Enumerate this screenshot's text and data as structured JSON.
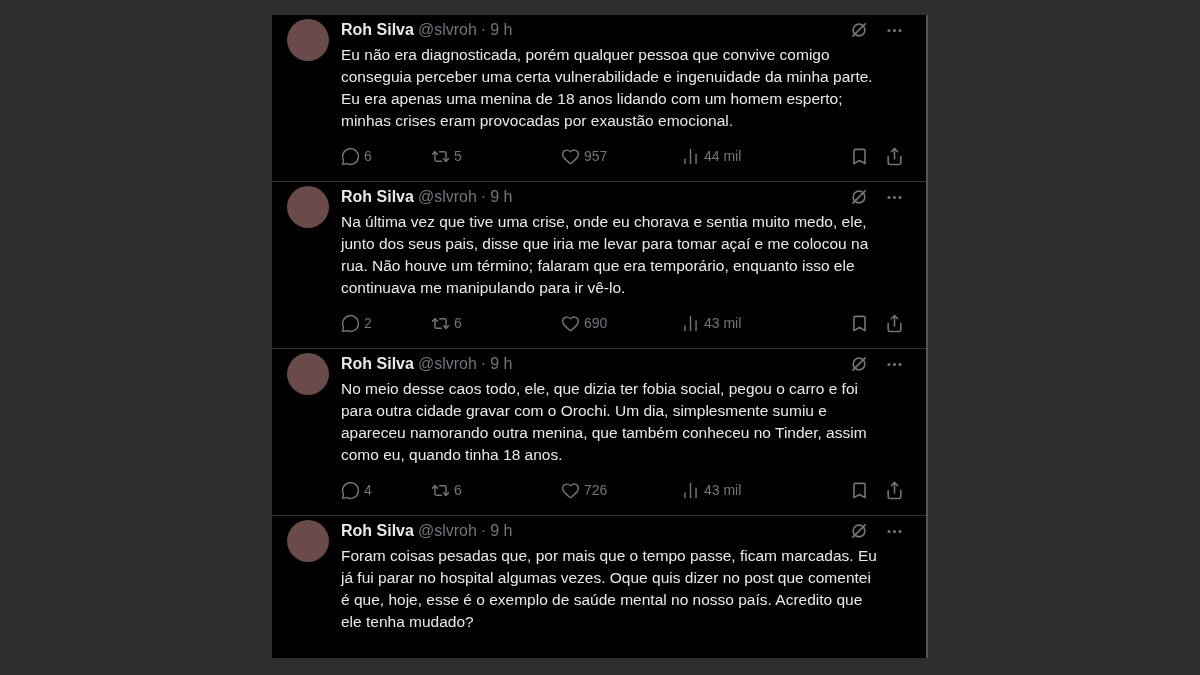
{
  "tweets": [
    {
      "name": "Roh Silva",
      "handle": "@slvroh",
      "separator": "·",
      "time": "9 h",
      "text": "Eu não era diagnosticada, porém qualquer pessoa que convive comigo conseguia perceber uma certa vulnerabilidade e ingenuidade da minha parte. Eu era apenas uma menina de 18 anos lidando com um homem esperto; minhas crises eram provocadas por exaustão emocional.",
      "stats": {
        "replies": "6",
        "reposts": "5",
        "likes": "957",
        "views": "44 mil"
      }
    },
    {
      "name": "Roh Silva",
      "handle": "@slvroh",
      "separator": "·",
      "time": "9 h",
      "text": "Na última vez que tive uma crise, onde eu chorava e sentia muito medo, ele, junto dos seus pais, disse que iria me levar para tomar açaí e me colocou na rua. Não houve um término; falaram que era temporário, enquanto isso ele continuava me manipulando para ir vê-lo.",
      "stats": {
        "replies": "2",
        "reposts": "6",
        "likes": "690",
        "views": "43 mil"
      }
    },
    {
      "name": "Roh Silva",
      "handle": "@slvroh",
      "separator": "·",
      "time": "9 h",
      "text": "No meio desse caos todo, ele, que dizia ter fobia social, pegou o carro e foi para outra cidade gravar com o Orochi. Um dia, simplesmente sumiu e apareceu namorando outra menina, que também conheceu no Tinder, assim como eu, quando tinha 18 anos.",
      "stats": {
        "replies": "4",
        "reposts": "6",
        "likes": "726",
        "views": "43 mil"
      }
    },
    {
      "name": "Roh Silva",
      "handle": "@slvroh",
      "separator": "·",
      "time": "9 h",
      "text": "Foram coisas pesadas que, por mais que o tempo passe, ficam marcadas. Eu já fui parar no hospital algumas vezes. Oque quis dizer no post que comentei é que, hoje, esse é o exemplo de saúde mental no nosso país. Acredito que ele tenha mudado?"
    }
  ]
}
